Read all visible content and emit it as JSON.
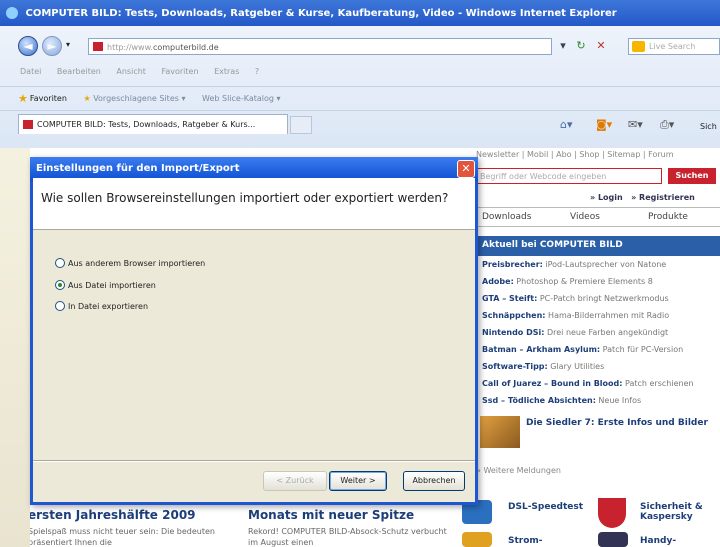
{
  "browser": {
    "window_title": "COMPUTER BILD: Tests, Downloads, Ratgeber & Kurse, Kaufberatung, Video - Windows Internet Explorer",
    "address_prefix": "http://www.",
    "address_domain": "computerbild.de",
    "search_placeholder": "Live Search",
    "menu_items": [
      "Datei",
      "Bearbeiten",
      "Ansicht",
      "Favoriten",
      "Extras",
      "?"
    ],
    "favorites_label": "Favoriten",
    "fav_suggested": "Vorgeschlagene Sites ▾",
    "fav_webslice": "Web Slice-Katalog ▾",
    "active_tab_title": "COMPUTER BILD: Tests, Downloads, Ratgeber & Kurs...",
    "cmd_safety_label": "Sich"
  },
  "site": {
    "top_links": "Newsletter | Mobil | Abo | Shop | Sitemap | Forum",
    "search_placeholder": "Begriff oder Webcode eingeben",
    "search_button": "Suchen",
    "login": "» Login",
    "register": "» Registrieren",
    "nav": [
      "Downloads",
      "Videos",
      "Produkte"
    ],
    "news_heading": "Aktuell bei COMPUTER BILD",
    "news": [
      {
        "bold": "Preisbrecher:",
        "text": " iPod-Lautsprecher von Natone"
      },
      {
        "bold": "Adobe:",
        "text": " Photoshop & Premiere Elements 8"
      },
      {
        "bold": "GTA – Steift:",
        "text": " PC-Patch bringt Netzwerkmodus"
      },
      {
        "bold": "Schnäppchen:",
        "text": " Hama-Bilderrahmen mit Radio"
      },
      {
        "bold": "Nintendo DSi:",
        "text": " Drei neue Farben angekündigt"
      },
      {
        "bold": "Batman – Arkham Asylum:",
        "text": " Patch für PC-Version"
      },
      {
        "bold": "Software-Tipp:",
        "text": " Glary Utilities"
      },
      {
        "bold": "Call of Juarez – Bound in Blood:",
        "text": " Patch erschienen"
      },
      {
        "bold": "Ssd – Tödliche Absichten:",
        "text": " Neue Infos"
      }
    ],
    "siedler": "Die Siedler 7: Erste Infos und Bilder",
    "weitere": "» Weitere Meldungen",
    "bottom_left_heading": "ersten Jahreshälfte 2009",
    "bottom_left_text": "Spielspaß muss nicht teuer sein: Die bedeuten präsentiert Ihnen die",
    "bottom_mid_heading": "Monats mit neuer Spitze",
    "bottom_mid_text": "Rekord! COMPUTER BILD-Absock-Schutz verbucht im August einen",
    "promos": [
      {
        "label": "DSL-Speedtest",
        "color": "#2b6fbf"
      },
      {
        "label": "Sicherheit & Kaspersky",
        "color": "#c8222e"
      },
      {
        "label": "Strom-",
        "color": "#e0a020"
      },
      {
        "label": "Handy-",
        "color": "#335"
      }
    ]
  },
  "dialog": {
    "title": "Einstellungen für den Import/Export",
    "close": "✕",
    "question": "Wie sollen Browsereinstellungen importiert oder exportiert werden?",
    "options": [
      {
        "label": "Aus anderem Browser importieren",
        "selected": false
      },
      {
        "label": "Aus Datei importieren",
        "selected": true
      },
      {
        "label": "In Datei exportieren",
        "selected": false
      }
    ],
    "back_button": "< Zurück",
    "next_button": "Weiter >",
    "cancel_button": "Abbrechen"
  }
}
